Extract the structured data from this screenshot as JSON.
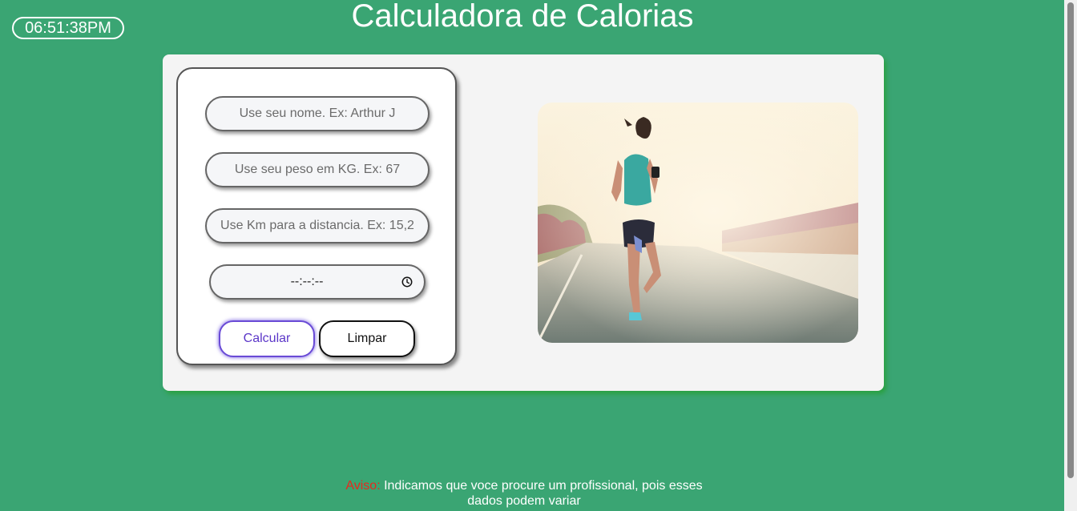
{
  "header": {
    "clock": "06:51:38PM",
    "title": "Calculadora de Calorias"
  },
  "form": {
    "name_placeholder": "Use seu nome. Ex: Arthur J",
    "weight_placeholder": "Use seu peso em KG. Ex: 67",
    "distance_placeholder": "Use Km para a distancia. Ex: 15,2",
    "time_value": "--:--:--",
    "calculate_label": "Calcular",
    "clear_label": "Limpar"
  },
  "photo": {
    "icon": "runner-photo"
  },
  "footer": {
    "notice_label": "Aviso:",
    "notice_text": " Indicamos que voce procure um profissional, pois esses dados podem variar"
  },
  "colors": {
    "background": "#3aa573",
    "card": "#f4f4f4",
    "calculate_accent": "#6a4bd6",
    "notice_label": "#e8281e"
  }
}
